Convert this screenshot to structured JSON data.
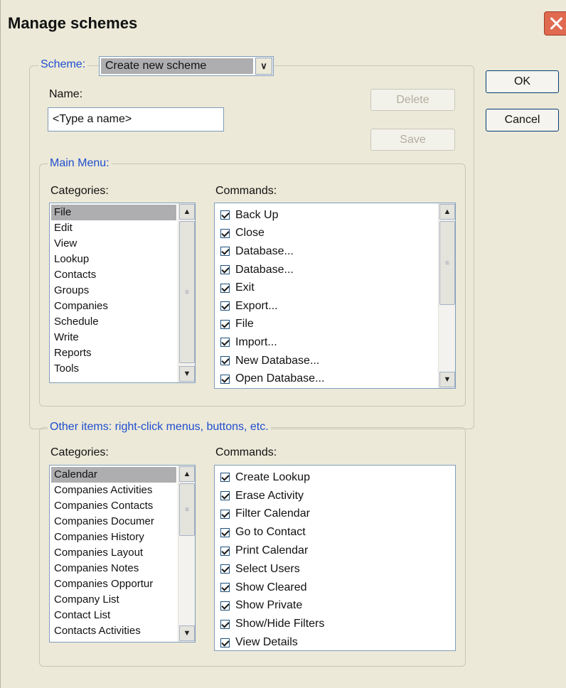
{
  "window": {
    "title": "Manage schemes"
  },
  "scheme": {
    "legend": "Scheme:",
    "selected": "Create new scheme",
    "name_label": "Name:",
    "name_value": "<Type a name>",
    "delete_label": "Delete",
    "save_label": "Save"
  },
  "dialog": {
    "ok_label": "OK",
    "cancel_label": "Cancel"
  },
  "main_menu": {
    "legend": "Main Menu:",
    "categories_label": "Categories:",
    "commands_label": "Commands:",
    "categories": [
      "File",
      "Edit",
      "View",
      "Lookup",
      "Contacts",
      "Groups",
      "Companies",
      "Schedule",
      "Write",
      "Reports",
      "Tools"
    ],
    "selected_category": "File",
    "commands": [
      {
        "label": "Back Up",
        "checked": true
      },
      {
        "label": "Close",
        "checked": true
      },
      {
        "label": "Database...",
        "checked": true
      },
      {
        "label": "Database...",
        "checked": true
      },
      {
        "label": "Exit",
        "checked": true
      },
      {
        "label": "Export...",
        "checked": true
      },
      {
        "label": "File",
        "checked": true
      },
      {
        "label": "Import...",
        "checked": true
      },
      {
        "label": "New Database...",
        "checked": true
      },
      {
        "label": "Open Database...",
        "checked": true
      }
    ]
  },
  "other_items": {
    "legend": "Other items: right-click menus, buttons, etc.",
    "categories_label": "Categories:",
    "commands_label": "Commands:",
    "categories": [
      "Calendar",
      "Companies Activities",
      "Companies Contacts",
      "Companies Documer",
      "Companies History",
      "Companies Layout",
      "Companies Notes",
      "Companies Opportur",
      "Company List",
      "Contact List",
      "Contacts Activities"
    ],
    "selected_category": "Calendar",
    "commands": [
      {
        "label": "Create Lookup",
        "checked": true
      },
      {
        "label": "Erase Activity",
        "checked": true
      },
      {
        "label": "Filter Calendar",
        "checked": true
      },
      {
        "label": "Go to Contact",
        "checked": true
      },
      {
        "label": "Print Calendar",
        "checked": true
      },
      {
        "label": "Select Users",
        "checked": true
      },
      {
        "label": "Show Cleared",
        "checked": true
      },
      {
        "label": "Show Private",
        "checked": true
      },
      {
        "label": "Show/Hide Filters",
        "checked": true
      },
      {
        "label": "View Details",
        "checked": true
      }
    ]
  },
  "icons": {
    "close": "close-icon",
    "dropdown": "chevron-down-icon",
    "scroll_up": "chevron-up-icon",
    "scroll_down": "chevron-down-icon",
    "checkbox": "checkmark-icon"
  }
}
